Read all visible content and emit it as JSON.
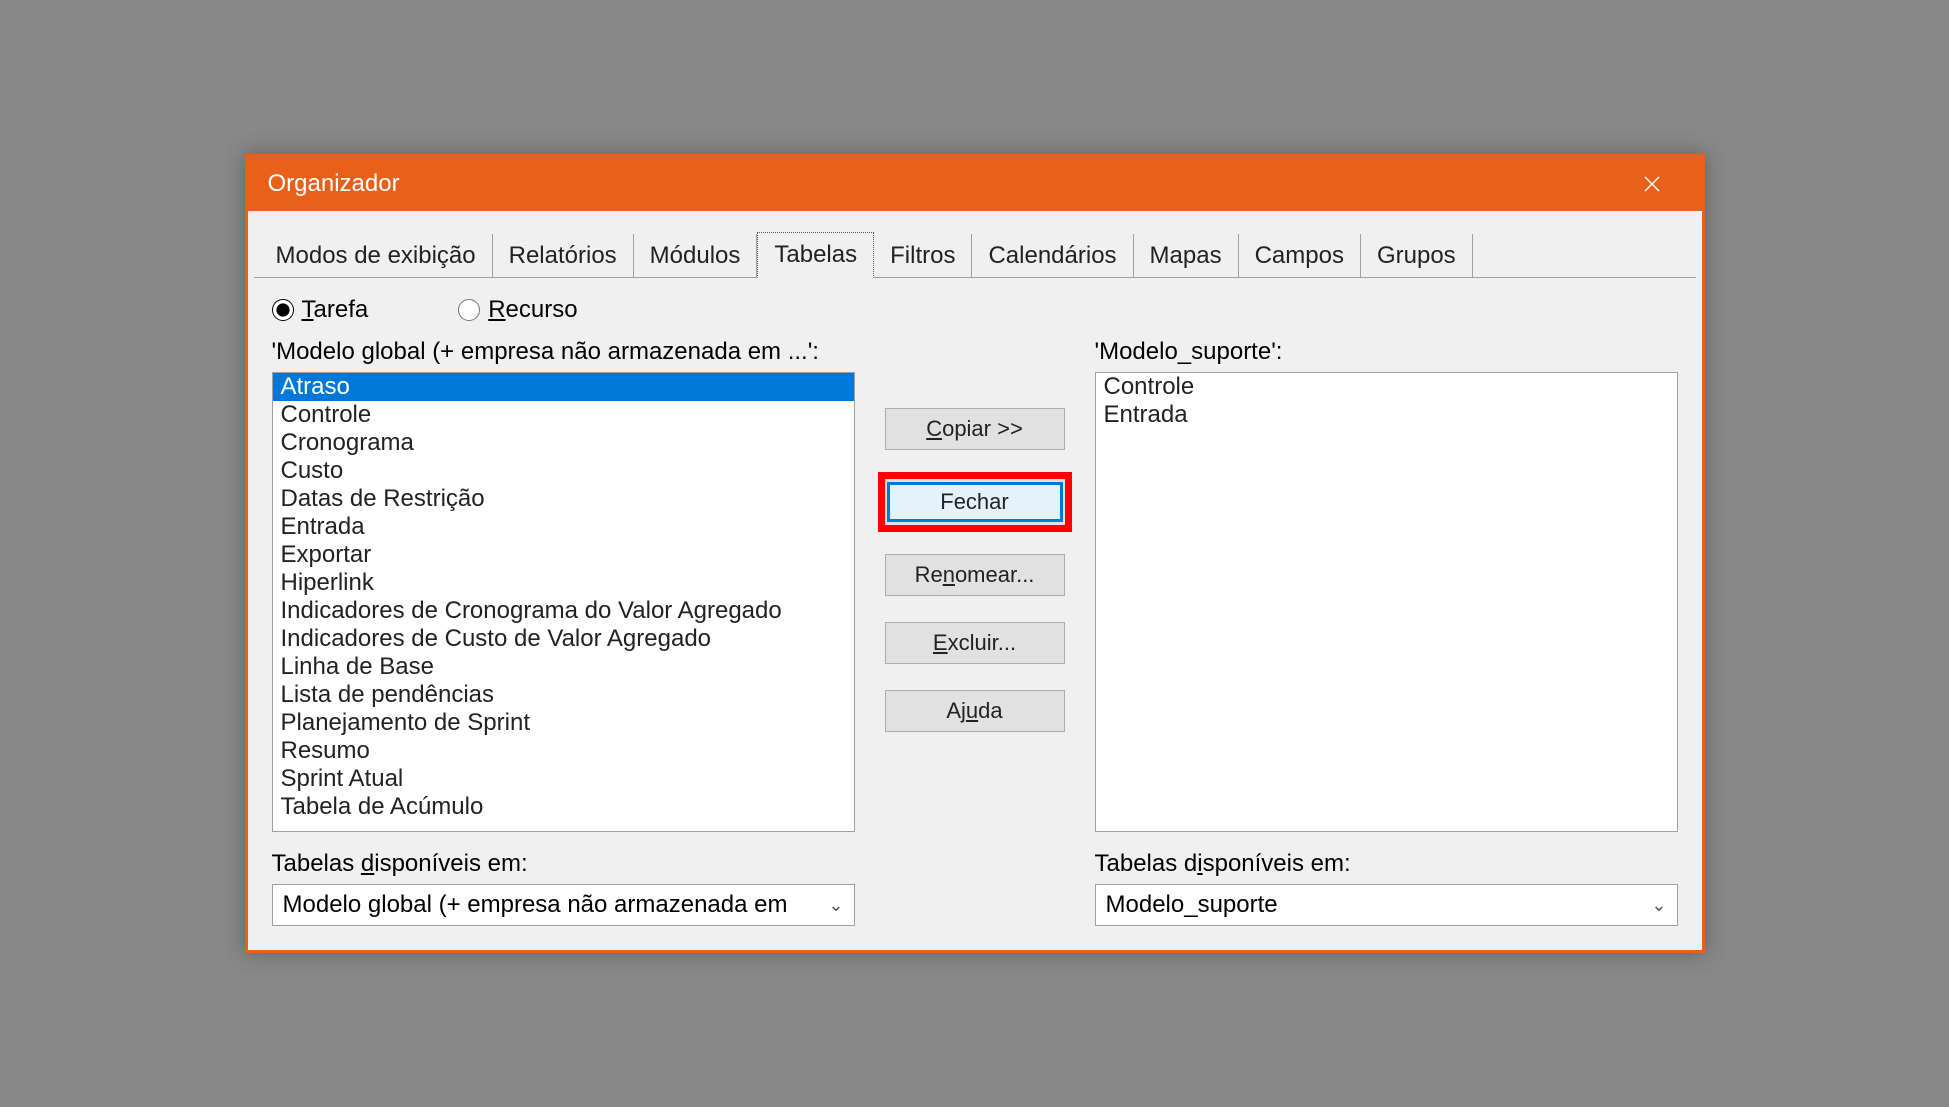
{
  "window": {
    "title": "Organizador"
  },
  "tabs": [
    "Modos de exibição",
    "Relatórios",
    "Módulos",
    "Tabelas",
    "Filtros",
    "Calendários",
    "Mapas",
    "Campos",
    "Grupos"
  ],
  "active_tab": "Tabelas",
  "radio": {
    "tarefa_prefix": "T",
    "tarefa_rest": "arefa",
    "recurso_prefix": "R",
    "recurso_rest": "ecurso",
    "selected": "Tarefa"
  },
  "left": {
    "label": "'Modelo global (+ empresa não armazenada em ...':",
    "items": [
      "Atraso",
      "Controle",
      "Cronograma",
      "Custo",
      "Datas de Restrição",
      "Entrada",
      "Exportar",
      "Hiperlink",
      "Indicadores de Cronograma do Valor Agregado",
      "Indicadores de Custo de Valor Agregado",
      "Linha de Base",
      "Lista de pendências",
      "Planejamento de Sprint",
      "Resumo",
      "Sprint Atual",
      "Tabela de Acúmulo"
    ],
    "selected_index": 0,
    "dropdown_label_prefix": "Tabelas ",
    "dropdown_label_ul": "d",
    "dropdown_label_suffix": "isponíveis em:",
    "dropdown_value": "Modelo global (+ empresa não armazenada em"
  },
  "right": {
    "label": "'Modelo_suporte':",
    "items": [
      "Controle",
      "Entrada"
    ],
    "dropdown_label_prefix": "Tabelas d",
    "dropdown_label_ul": "i",
    "dropdown_label_suffix": "sponíveis em:",
    "dropdown_value": "Modelo_suporte"
  },
  "buttons": {
    "copiar_ul": "C",
    "copiar_rest": "opiar >>",
    "fechar": "Fechar",
    "renomear_pre": "Re",
    "renomear_ul": "n",
    "renomear_post": "omear...",
    "excluir_ul": "E",
    "excluir_rest": "xcluir...",
    "ajuda_pre": "Aj",
    "ajuda_ul": "u",
    "ajuda_post": "da"
  }
}
